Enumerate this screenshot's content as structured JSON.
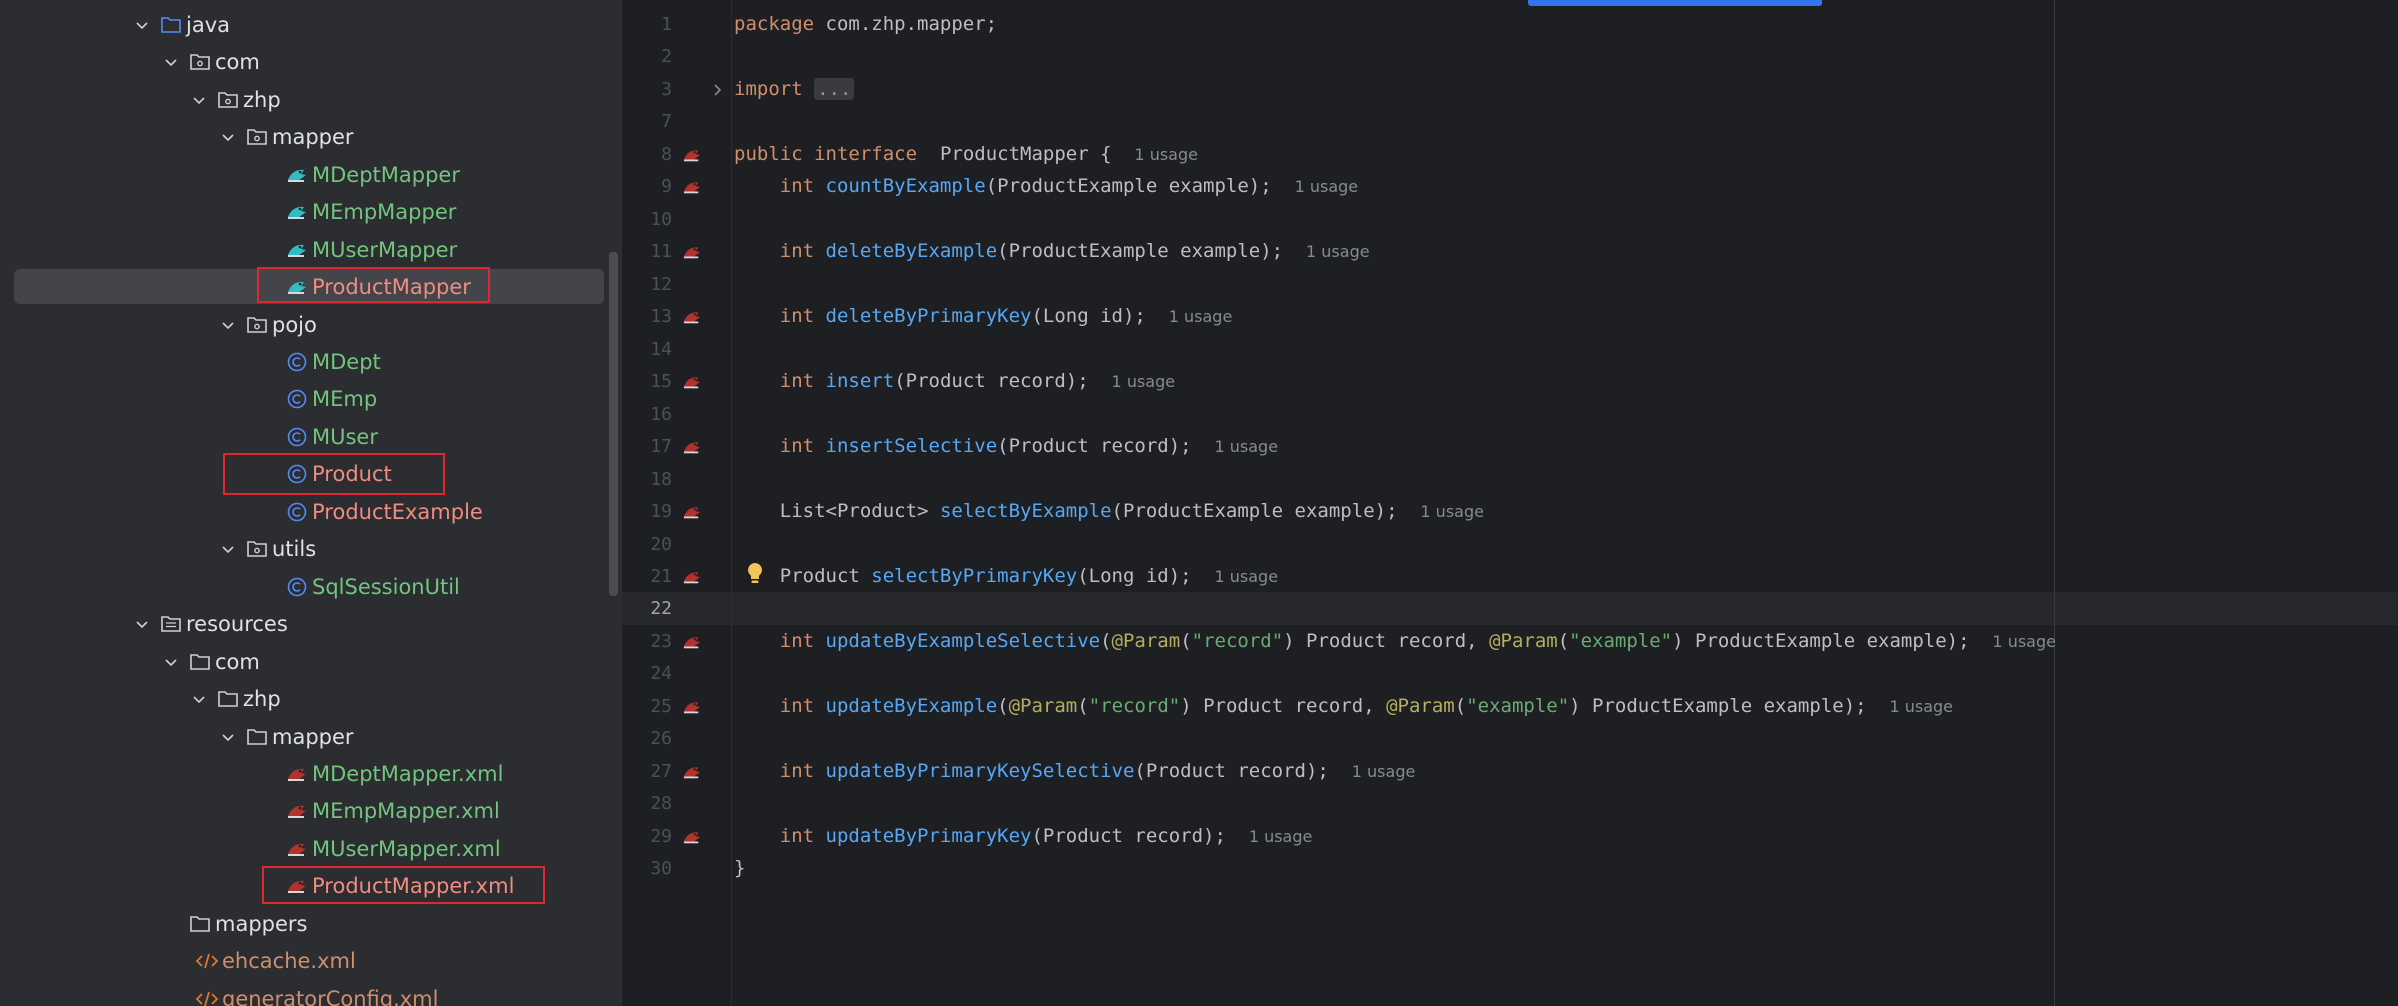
{
  "project_tree": {
    "items": [
      {
        "label": "java",
        "color": "default"
      },
      {
        "label": "com",
        "color": "default"
      },
      {
        "label": "zhp",
        "color": "default"
      },
      {
        "label": "mapper",
        "color": "default"
      },
      {
        "label": "MDeptMapper",
        "color": "green"
      },
      {
        "label": "MEmpMapper",
        "color": "green"
      },
      {
        "label": "MUserMapper",
        "color": "green"
      },
      {
        "label": "ProductMapper",
        "color": "red"
      },
      {
        "label": "pojo",
        "color": "default"
      },
      {
        "label": "MDept",
        "color": "green"
      },
      {
        "label": "MEmp",
        "color": "green"
      },
      {
        "label": "MUser",
        "color": "green"
      },
      {
        "label": "Product",
        "color": "red"
      },
      {
        "label": "ProductExample",
        "color": "red"
      },
      {
        "label": "utils",
        "color": "default"
      },
      {
        "label": "SqlSessionUtil",
        "color": "green"
      },
      {
        "label": "resources",
        "color": "default"
      },
      {
        "label": "com",
        "color": "default"
      },
      {
        "label": "zhp",
        "color": "default"
      },
      {
        "label": "mapper",
        "color": "default"
      },
      {
        "label": "MDeptMapper.xml",
        "color": "green"
      },
      {
        "label": "MEmpMapper.xml",
        "color": "green"
      },
      {
        "label": "MUserMapper.xml",
        "color": "green"
      },
      {
        "label": "ProductMapper.xml",
        "color": "red"
      },
      {
        "label": "mappers",
        "color": "default"
      },
      {
        "label": "ehcache.xml",
        "color": "orange"
      },
      {
        "label": "generatorConfig.xml",
        "color": "orange"
      }
    ]
  },
  "editor": {
    "file": "ProductMapper.java",
    "current_line": 22,
    "line_numbers": [
      "1",
      "2",
      "3",
      "7",
      "8",
      "9",
      "10",
      "11",
      "12",
      "13",
      "14",
      "15",
      "16",
      "17",
      "18",
      "19",
      "20",
      "21",
      "22",
      "23",
      "24",
      "25",
      "26",
      "27",
      "28",
      "29",
      "30"
    ],
    "lines": {
      "l1": {
        "kw": "package",
        "rest": " com.zhp.mapper;"
      },
      "l3": {
        "kw": "import",
        "fold": "..."
      },
      "l8": {
        "kw1": "public",
        "kw2": "interface",
        "name": " ProductMapper {",
        "hint": "1 usage"
      },
      "l9": {
        "kw": "int",
        "fn": "countByExample",
        "rest": "(ProductExample example);",
        "hint": "1 usage"
      },
      "l11": {
        "kw": "int",
        "fn": "deleteByExample",
        "rest": "(ProductExample example);",
        "hint": "1 usage"
      },
      "l13": {
        "kw": "int",
        "fn": "deleteByPrimaryKey",
        "rest": "(Long id);",
        "hint": "1 usage"
      },
      "l15": {
        "kw": "int",
        "fn": "insert",
        "rest": "(Product record);",
        "hint": "1 usage"
      },
      "l17": {
        "kw": "int",
        "fn": "insertSelective",
        "rest": "(Product record);",
        "hint": "1 usage"
      },
      "l19": {
        "type": "List<Product>",
        "fn": "selectByExample",
        "rest": "(ProductExample example);",
        "hint": "1 usage"
      },
      "l21": {
        "type": "Product",
        "fn": "selectByPrimaryKey",
        "rest": "(Long id);",
        "hint": "1 usage"
      },
      "l23": {
        "kw": "int",
        "fn": "updateByExampleSelective",
        "ann": "@Param",
        "s1": "\"record\"",
        "mid": ") Product record, ",
        "s2": "\"example\"",
        "rest": ") ProductExample example);",
        "hint": "1 usage"
      },
      "l25": {
        "kw": "int",
        "fn": "updateByExample",
        "ann": "@Param",
        "s1": "\"record\"",
        "mid": ") Product record, ",
        "s2": "\"example\"",
        "rest": ") ProductExample example);",
        "hint": "1 usage"
      },
      "l27": {
        "kw": "int",
        "fn": "updateByPrimaryKeySelective",
        "rest": "(Product record);",
        "hint": "1 usage"
      },
      "l29": {
        "kw": "int",
        "fn": "updateByPrimaryKey",
        "rest": "(Product record);",
        "hint": "1 usage"
      },
      "l30": {
        "rest": "}"
      }
    }
  },
  "colors": {
    "keyword": "#cf8e6d",
    "function": "#56a8f5",
    "annotation": "#b3ae60",
    "string": "#6aab73",
    "vcs_added": "#72c47e",
    "vcs_unversioned": "#f08c80",
    "highlight_box": "#e0262e",
    "accent": "#3574f0"
  }
}
